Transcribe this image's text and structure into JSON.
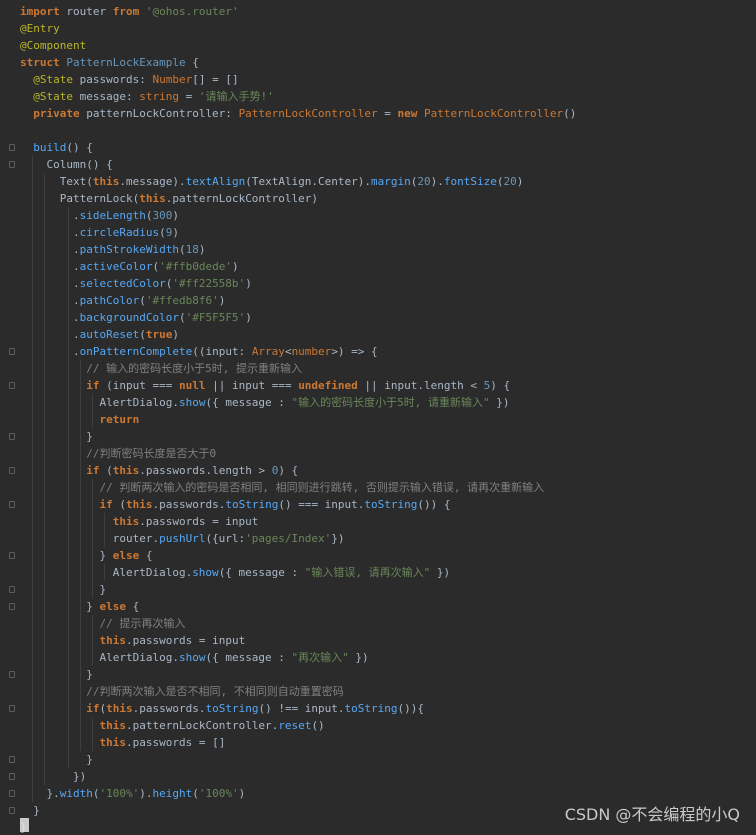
{
  "editor": {
    "lines": [
      "import router from '@ohos.router'",
      "@Entry",
      "@Component",
      "struct PatternLockExample {",
      "  @State passwords: Number[] = []",
      "  @State message: string = '请输入手势!'",
      "  private patternLockController: PatternLockController = new PatternLockController()",
      "",
      "  build() {",
      "    Column() {",
      "      Text(this.message).textAlign(TextAlign.Center).margin(20).fontSize(20)",
      "      PatternLock(this.patternLockController)",
      "        .sideLength(300)",
      "        .circleRadius(9)",
      "        .pathStrokeWidth(18)",
      "        .activeColor('#ffb0dede')",
      "        .selectedColor('#ff22558b')",
      "        .pathColor('#ffedb8f6')",
      "        .backgroundColor('#F5F5F5')",
      "        .autoReset(true)",
      "        .onPatternComplete((input: Array<number>) => {",
      "          // 输入的密码长度小于5时, 提示重新输入",
      "          if (input === null || input === undefined || input.length < 5) {",
      "            AlertDialog.show({ message : \"输入的密码长度小于5时, 请重新输入\" })",
      "            return",
      "          }",
      "          //判断密码长度是否大于0",
      "          if (this.passwords.length > 0) {",
      "            // 判断两次输入的密码是否相同, 相同则进行跳转, 否则提示输入错误, 请再次重新输入",
      "            if (this.passwords.toString() === input.toString()) {",
      "              this.passwords = input",
      "              router.pushUrl({url:'pages/Index'})",
      "            } else {",
      "              AlertDialog.show({ message : \"输入错误, 请再次输入\" })",
      "            }",
      "          } else {",
      "            // 提示再次输入",
      "            this.passwords = input",
      "            AlertDialog.show({ message : \"再次输入\" })",
      "          }",
      "          //判断两次输入是否不相同, 不相同则自动重置密码",
      "          if(this.passwords.toString() !== input.toString()){",
      "            this.patternLockController.reset()",
      "            this.passwords = []",
      "          }",
      "        })",
      "    }.width('100%').height('100%')",
      "  }",
      "}"
    ]
  },
  "watermark": "CSDN @不会编程的小Q"
}
